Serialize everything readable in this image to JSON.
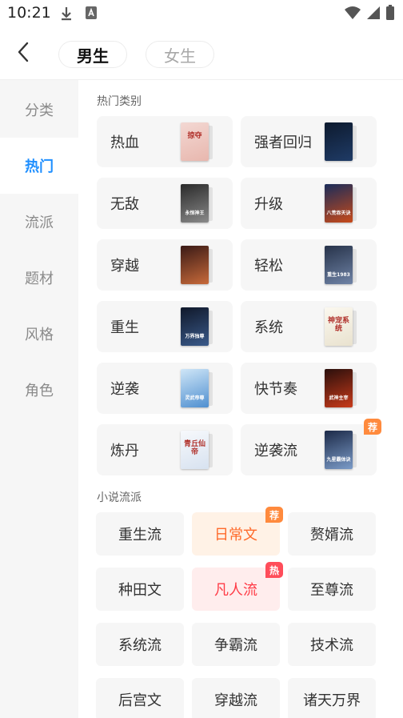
{
  "status_bar": {
    "time": "10:21",
    "icons": [
      "download-icon",
      "sim-card-icon",
      "wifi-icon",
      "signal-icon",
      "battery-icon"
    ]
  },
  "header": {
    "tabs": [
      {
        "label": "男生",
        "active": true
      },
      {
        "label": "女生",
        "active": false
      }
    ]
  },
  "sidebar": {
    "items": [
      {
        "label": "分类",
        "active": false
      },
      {
        "label": "热门",
        "active": true
      },
      {
        "label": "流派",
        "active": false
      },
      {
        "label": "题材",
        "active": false
      },
      {
        "label": "风格",
        "active": false
      },
      {
        "label": "角色",
        "active": false
      }
    ]
  },
  "hot_section": {
    "title": "热门类别",
    "categories": [
      {
        "label": "热血",
        "cover_text": "掠夺",
        "cover_colors": [
          "#f3d8d3",
          "#e8b7ae"
        ],
        "dark_text": true
      },
      {
        "label": "强者回归",
        "cover_text": "",
        "cover_colors": [
          "#0d1a2e",
          "#1f3b66"
        ]
      },
      {
        "label": "无敌",
        "cover_text": "永恒神王",
        "cover_colors": [
          "#2a2a2a",
          "#8a8a8a"
        ]
      },
      {
        "label": "升级",
        "cover_text": "八荒吞天诀",
        "cover_colors": [
          "#1a2c5a",
          "#c84a1a"
        ]
      },
      {
        "label": "穿越",
        "cover_text": "",
        "cover_colors": [
          "#3a1a16",
          "#c86a3a"
        ]
      },
      {
        "label": "轻松",
        "cover_text": "重生1983",
        "cover_colors": [
          "#27334a",
          "#6f83a6"
        ]
      },
      {
        "label": "重生",
        "cover_text": "万界独尊",
        "cover_colors": [
          "#10182a",
          "#3a5a8a"
        ]
      },
      {
        "label": "系统",
        "cover_text": "神宠系统",
        "cover_colors": [
          "#fbf8ef",
          "#e9e2cf"
        ],
        "dark_text": true
      },
      {
        "label": "逆袭",
        "cover_text": "灵武帝尊",
        "cover_colors": [
          "#cfe6f7",
          "#4f8fd0"
        ]
      },
      {
        "label": "快节奏",
        "cover_text": "武神主宰",
        "cover_colors": [
          "#2a0f0c",
          "#c83a1a"
        ]
      },
      {
        "label": "炼丹",
        "cover_text": "青丘仙帝",
        "cover_colors": [
          "#f7f9fc",
          "#d7e2f0"
        ],
        "dark_text": true
      },
      {
        "label": "逆袭流",
        "cover_text": "九星霸体诀",
        "cover_colors": [
          "#1c2a48",
          "#7b9bc8"
        ],
        "badge": "荐"
      }
    ]
  },
  "genre_section": {
    "title": "小说流派",
    "chips": [
      {
        "label": "重生流"
      },
      {
        "label": "日常文",
        "badge": "荐",
        "highlight": "orange"
      },
      {
        "label": "赘婿流"
      },
      {
        "label": "种田文"
      },
      {
        "label": "凡人流",
        "badge": "热",
        "highlight": "red"
      },
      {
        "label": "至尊流"
      },
      {
        "label": "系统流"
      },
      {
        "label": "争霸流"
      },
      {
        "label": "技术流"
      },
      {
        "label": "后宫文"
      },
      {
        "label": "穿越流"
      },
      {
        "label": "诸天万界"
      }
    ]
  },
  "colors": {
    "accent": "#1f8fff",
    "badge_orange": "#ff8a3d",
    "badge_red": "#ff4d5a",
    "chip_orange_bg": "#fff2e6",
    "chip_orange_text": "#ff6a2a",
    "chip_red_bg": "#ffeded",
    "chip_red_text": "#ff3a45"
  }
}
